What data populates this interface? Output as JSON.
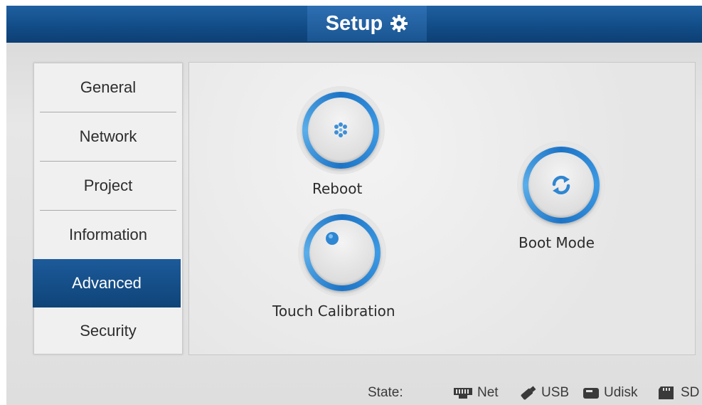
{
  "header": {
    "title": "Setup",
    "icon": "gear-icon"
  },
  "nav": {
    "items": [
      {
        "label": "General",
        "active": false
      },
      {
        "label": "Network",
        "active": false
      },
      {
        "label": "Project",
        "active": false
      },
      {
        "label": "Information",
        "active": false
      },
      {
        "label": "Advanced",
        "active": true
      },
      {
        "label": "Security",
        "active": false
      }
    ]
  },
  "panel": {
    "reboot": {
      "label": "Reboot",
      "icon": "reboot-icon"
    },
    "boot_mode": {
      "label": "Boot Mode",
      "icon": "refresh-icon"
    },
    "touch_calibration": {
      "label": "Touch Calibration",
      "icon": "calibration-dot-icon"
    }
  },
  "status": {
    "label": "State:",
    "items": [
      {
        "label": "Net",
        "icon": "ethernet-icon"
      },
      {
        "label": "USB",
        "icon": "usb-icon"
      },
      {
        "label": "Udisk",
        "icon": "udisk-icon"
      },
      {
        "label": "SD",
        "icon": "sd-card-icon"
      }
    ]
  },
  "colors": {
    "accent": "#1d74c6",
    "header": "#124d88",
    "active_nav": "#15508c"
  }
}
